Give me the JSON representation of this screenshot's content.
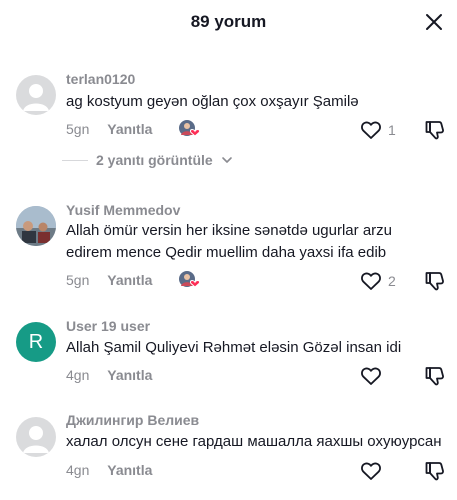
{
  "header": {
    "title": "89 yorum"
  },
  "comments": [
    {
      "username": "terlan0120",
      "text": "ag kostyum geyən oğlan çox oxşayır Şamilə",
      "time": "5gn",
      "reply_label": "Yanıtla",
      "likes": "1"
    },
    {
      "username": "Yusif Memmedov",
      "text": "Allah ömür versin her iksine sənətdə ugurlar arzu edirem mence Qedir muellim daha yaxsi ifa edib",
      "time": "5gn",
      "reply_label": "Yanıtla",
      "likes": "2"
    },
    {
      "username": "User 19 user",
      "avatar_letter": "R",
      "text": "Allah Şamil Quliyevi Rəhmət eləsin Gözəl insan idi",
      "time": "4gn",
      "reply_label": "Yanıtla",
      "likes": ""
    },
    {
      "username": "Джилингир Велиев",
      "text": "халал олсун сене гардаш машалла яахшы охуюурсан",
      "time": "4gn",
      "reply_label": "Yanıtla",
      "likes": ""
    }
  ],
  "view_replies": {
    "label": "2 yanıtı görüntüle"
  },
  "colors": {
    "text": "#161823",
    "secondary": "#8a8b91",
    "avatar_r": "#169b86",
    "heart_badge": "#fe2c55"
  },
  "icons": {
    "close": "close-icon",
    "like": "heart-outline-icon",
    "dislike": "thumbs-down-icon",
    "chevron": "chevron-down-icon"
  }
}
